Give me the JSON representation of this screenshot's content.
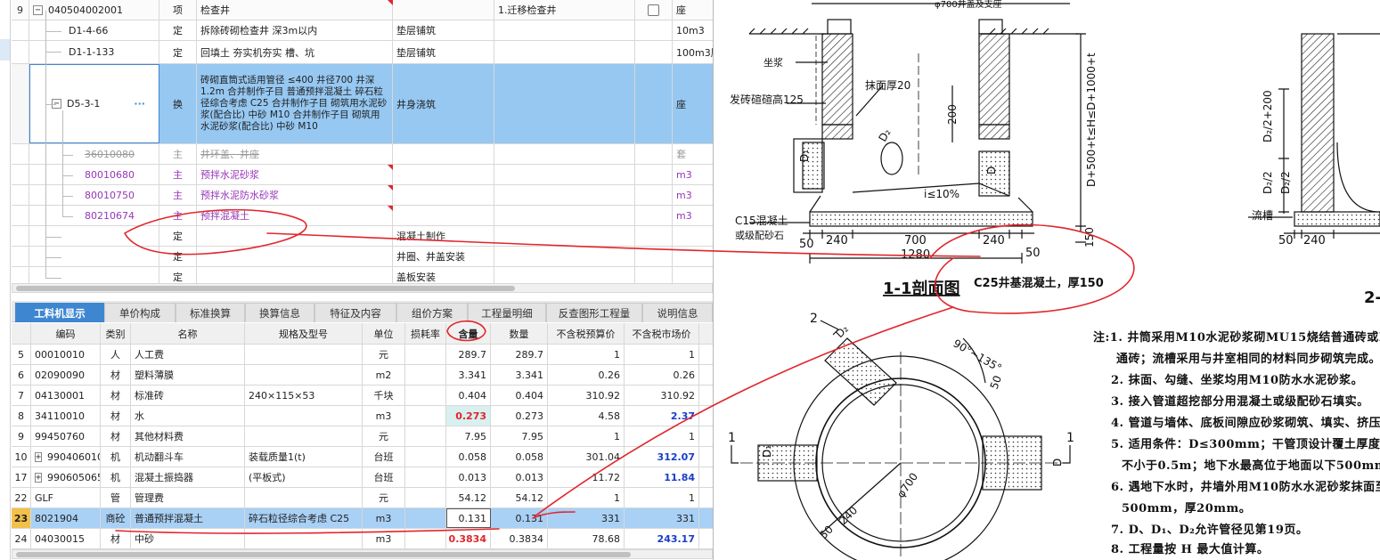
{
  "upper_table": {
    "rows": [
      {
        "idx": "9",
        "code": "040504002001",
        "type": "项",
        "name": "检查井",
        "feature": "",
        "work": "1.迁移检查井",
        "unit": "座"
      },
      {
        "code": "D1-4-66",
        "type": "定",
        "name": "拆除砖砌检查井 深3m以内",
        "feature": "垫层铺筑",
        "unit": "10m3"
      },
      {
        "code": "D1-1-133",
        "type": "定",
        "name": "回填土 夯实机夯实 槽、坑",
        "feature": "垫层铺筑",
        "unit": "100m3压"
      },
      {
        "code": "D5-3-1",
        "dots": "···",
        "type": "换",
        "name": "砖砌直筒式适用管径 ≤400 井径700 井深1.2m 合并制作子目 普通预拌混凝土 碎石粒径综合考虑 C25 合并制作子目 砌筑用水泥砂浆(配合比) 中砂 M10 合并制作子目 砌筑用水泥砂浆(配合比) 中砂 M10",
        "feature": "井身浇筑",
        "unit": "座"
      },
      {
        "code": "36010080",
        "type": "主",
        "name": "井环盖、井座",
        "unit": "套"
      },
      {
        "code": "80010680",
        "type": "主",
        "name": "预拌水泥砂浆",
        "unit": "m3"
      },
      {
        "code": "80010750",
        "type": "主",
        "name": "预拌水泥防水砂浆",
        "unit": "m3"
      },
      {
        "code": "80210674",
        "type": "主",
        "name": "预拌混凝土",
        "unit": "m3"
      },
      {
        "code": "",
        "type": "定",
        "name": "",
        "feature": "混凝土制作",
        "unit": ""
      },
      {
        "code": "",
        "type": "定",
        "name": "",
        "feature": "井圈、井盖安装",
        "unit": ""
      },
      {
        "code": "",
        "type": "定",
        "name": "",
        "feature": "盖板安装",
        "unit": ""
      }
    ]
  },
  "tabs": [
    "工料机显示",
    "单价构成",
    "标准换算",
    "换算信息",
    "特征及内容",
    "组价方案",
    "工程量明细",
    "反查图形工程量",
    "说明信息"
  ],
  "lower_table": {
    "headers": {
      "code": "编码",
      "type": "类别",
      "name": "名称",
      "spec": "规格及型号",
      "unit": "单位",
      "loss": "损耗率",
      "qty": "含量",
      "amt": "数量",
      "bud": "不含税预算价",
      "mkt": "不含税市场价"
    },
    "rows": [
      {
        "idx": "5",
        "code": "00010010",
        "type": "人",
        "name": "人工费",
        "spec": "",
        "unit": "元",
        "qty": "289.7",
        "amt": "289.7",
        "bud": "1",
        "mkt": "1"
      },
      {
        "idx": "6",
        "code": "02090090",
        "type": "材",
        "name": "塑料薄膜",
        "spec": "",
        "unit": "m2",
        "qty": "3.341",
        "amt": "3.341",
        "bud": "0.26",
        "mkt": "0.26"
      },
      {
        "idx": "7",
        "code": "04130001",
        "type": "材",
        "name": "标准砖",
        "spec": "240×115×53",
        "unit": "千块",
        "qty": "0.404",
        "amt": "0.404",
        "bud": "310.92",
        "mkt": "310.92"
      },
      {
        "idx": "8",
        "code": "34110010",
        "type": "材",
        "name": "水",
        "spec": "",
        "unit": "m3",
        "qty": "0.273",
        "amt": "0.273",
        "bud": "4.58",
        "mkt": "2.37"
      },
      {
        "idx": "9",
        "code": "99450760",
        "type": "材",
        "name": "其他材料费",
        "spec": "",
        "unit": "元",
        "qty": "7.95",
        "amt": "7.95",
        "bud": "1",
        "mkt": "1"
      },
      {
        "idx": "10",
        "expand": "+",
        "code": "990406010",
        "type": "机",
        "name": "机动翻斗车",
        "spec": "装载质量1(t)",
        "unit": "台班",
        "qty": "0.058",
        "amt": "0.058",
        "bud": "301.04",
        "mkt": "312.07"
      },
      {
        "idx": "17",
        "expand": "+",
        "code": "990605065",
        "type": "机",
        "name": "混凝土振捣器",
        "spec": "(平板式)",
        "unit": "台班",
        "qty": "0.013",
        "amt": "0.013",
        "bud": "11.72",
        "mkt": "11.84"
      },
      {
        "idx": "22",
        "code": "GLF",
        "type": "管",
        "name": "管理费",
        "spec": "",
        "unit": "元",
        "qty": "54.12",
        "amt": "54.12",
        "bud": "1",
        "mkt": "1"
      },
      {
        "idx": "23",
        "code": "8021904",
        "type": "商砼",
        "name": "普通预拌混凝土",
        "spec": "碎石粒径综合考虑 C25",
        "unit": "m3",
        "qty": "0.131",
        "amt": "0.131",
        "bud": "331",
        "mkt": "331"
      },
      {
        "idx": "24",
        "code": "04030015",
        "type": "材",
        "name": "中砂",
        "spec": "",
        "unit": "m3",
        "qty": "0.3834",
        "amt": "0.3834",
        "bud": "78.68",
        "mkt": "243.17"
      }
    ]
  },
  "drawing": {
    "top_label": "φ700井盖及支座",
    "lbl_zuojiang": "坐浆",
    "lbl_fazhuan": "发砖碹碹高125",
    "lbl_mohou": "抹面厚20",
    "lbl_200": "200",
    "lbl_d2": "D₂",
    "lbl_d1": "D₁",
    "lbl_d": "D",
    "lbl_slope": "i≤10%",
    "lbl_h": "D+500+t≤H≤D+1000+t",
    "lbl_c15a": "C15混凝土",
    "lbl_c15b": "或级配砂石",
    "lbl_50a": "50",
    "lbl_240a": "240",
    "lbl_700": "700",
    "lbl_240b": "240",
    "lbl_50b": "50",
    "lbl_1280": "1280",
    "lbl_150": "150",
    "lbl_c25": "C25井基混凝土，厚150",
    "section_title": "1-1剖面图",
    "r_d2a": "D₂/2+200",
    "r_d2b": "D₂/2",
    "r_d2c": "D₂/2",
    "r_liucao": "流槽",
    "r_50": "50",
    "r_240": "240",
    "r_title": "2-",
    "p_2": "2",
    "p_angle": "90°~135°",
    "p_d2": "D₂",
    "p_50": "50",
    "p_1l": "1",
    "p_1r": "1",
    "p_d1": "D₁",
    "p_d": "D",
    "p_700": "φ700",
    "p_240": "240",
    "p_50b": "50",
    "notes": [
      "注:1. 井筒采用M10水泥砂浆砌MU15烧结普通砖或MU20",
      "通砖；流槽采用与井室相同的材料同步砌筑完成。",
      "2. 抹面、勾缝、坐浆均用M10防水水泥砂浆。",
      "3. 接入管道超挖部分用混凝土或级配砂石填实。",
      "4. 管道与墙体、底板间隙应砂浆砌筑、填实、挤压严密",
      "5. 适用条件：D≤300mm；干管顶设计覆土厚度不大",
      "不小于0.5m；地下水最高位于地面以下500mm。",
      "6. 遇地下水时，井墙外用M10防水水泥砂浆抹面至地下",
      "500mm，厚20mm。",
      "7. D、D₁、D₂允许管径见第19页。",
      "8. 工程量按 H 最大值计算。"
    ]
  },
  "colors": {
    "accent": "#3f86d0",
    "selected_row": "#96c8f2",
    "annotation": "#e0262c",
    "purple_text": "#9636b8"
  }
}
